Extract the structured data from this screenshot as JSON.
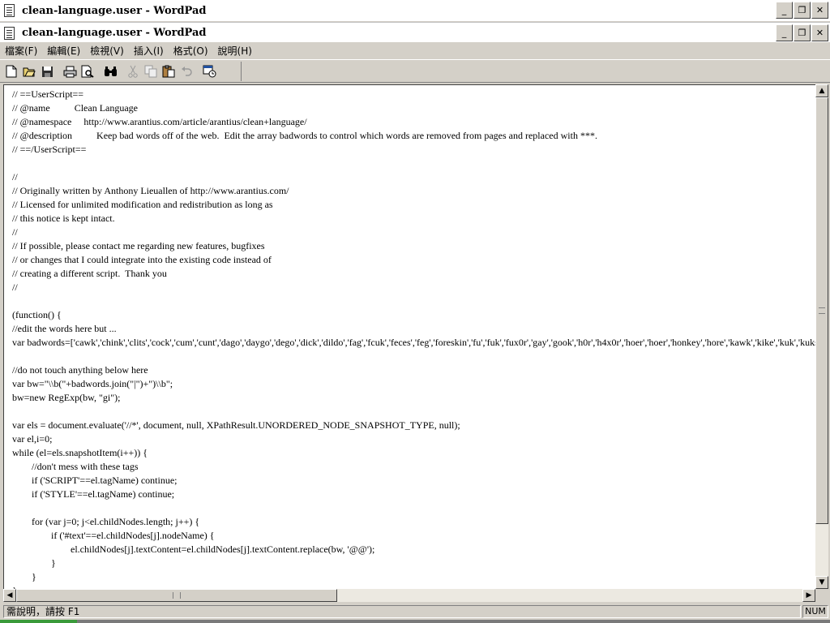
{
  "outer_window": {
    "title": "clean-language.user - WordPad"
  },
  "inner_window": {
    "title": "clean-language.user - WordPad"
  },
  "window_buttons": {
    "minimize": "_",
    "restore": "❐",
    "close": "✕"
  },
  "menu": [
    "檔案(F)",
    "編輯(E)",
    "檢視(V)",
    "插入(I)",
    "格式(O)",
    "說明(H)"
  ],
  "toolbar": {
    "buttons": [
      "new-icon",
      "open-icon",
      "save-icon",
      "print-icon",
      "print-preview-icon",
      "find-icon",
      "cut-icon",
      "copy-icon",
      "paste-icon",
      "undo-icon",
      "insert-datetime-icon"
    ]
  },
  "editor": {
    "text": "// ==UserScript==\n// @name          Clean Language\n// @namespace     http://www.arantius.com/article/arantius/clean+language/\n// @description          Keep bad words off of the web.  Edit the array badwords to control which words are removed from pages and replaced with ***.\n// ==/UserScript==\n\n//\n// Originally written by Anthony Lieuallen of http://www.arantius.com/\n// Licensed for unlimited modification and redistribution as long as\n// this notice is kept intact.\n//\n// If possible, please contact me regarding new features, bugfixes\n// or changes that I could integrate into the existing code instead of\n// creating a different script.  Thank you\n//\n\n(function() {\n//edit the words here but ...\nvar badwords=['cawk','chink','clits','cock','cum','cunt','dago','daygo','dego','dick','dildo','fag','fcuk','feces','feg','foreskin','fu','fuk','fux0r','gay','gook','h0r','h4x0r','hoer','hoer','honkey','hore','kawk','kike','kuk','kuksuger',\n\n//do not touch anything below here\nvar bw=\"\\\\b(\"+badwords.join(\"|\")+\")\\\\b\";\nbw=new RegExp(bw, \"gi\");\n\nvar els = document.evaluate('//*', document, null, XPathResult.UNORDERED_NODE_SNAPSHOT_TYPE, null);\nvar el,i=0;\nwhile (el=els.snapshotItem(i++)) {\n\t\t//don't mess with these tags\n\t\tif ('SCRIPT'==el.tagName) continue;\n\t\tif ('STYLE'==el.tagName) continue;\n\n\t\tfor (var j=0; j<el.childNodes.length; j++) {\n\t\t\t\tif ('#text'==el.childNodes[j].nodeName) {\n\t\t\t\t\t\tel.childNodes[j].textContent=el.childNodes[j].textContent.replace(bw, '@@');\n\t\t\t\t}\n\t\t}\n}"
  },
  "statusbar": {
    "help": "需說明，請按 F1",
    "num": "NUM"
  }
}
